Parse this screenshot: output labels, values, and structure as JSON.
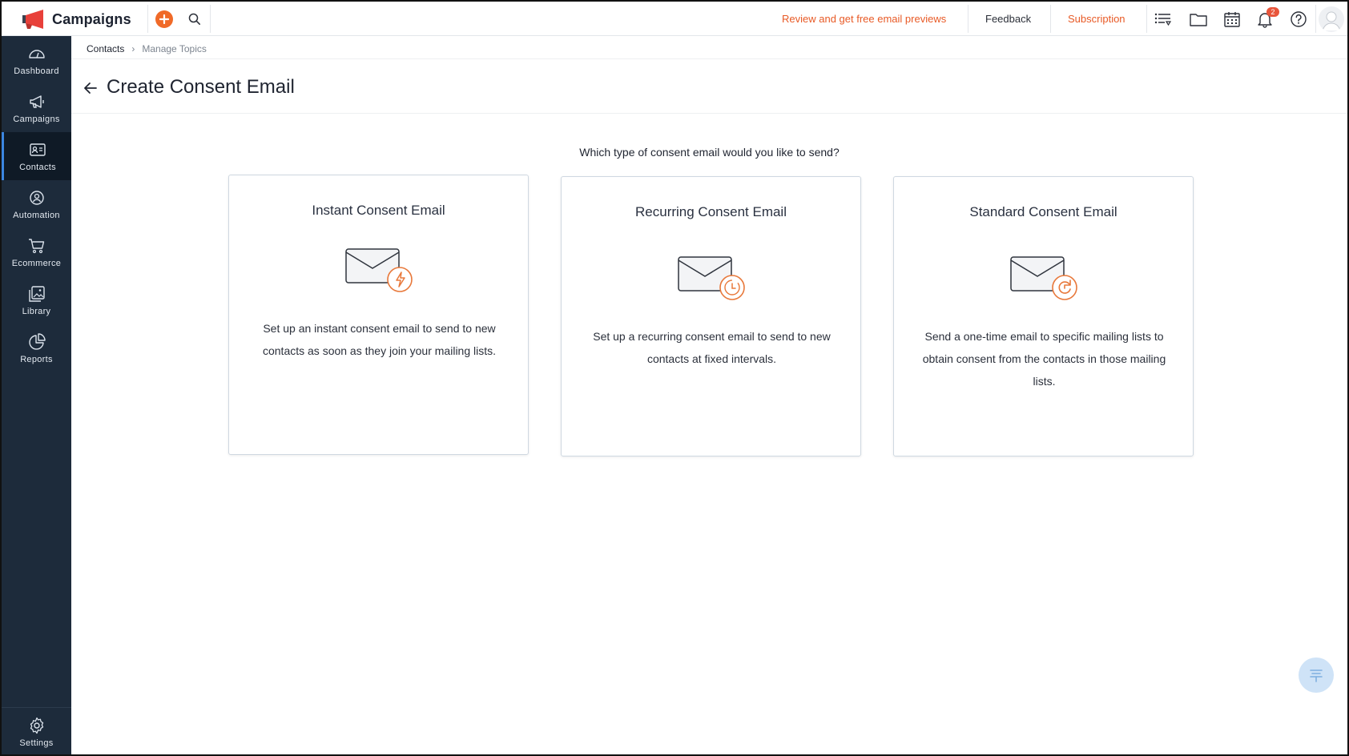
{
  "app": {
    "title": "Campaigns"
  },
  "topbar": {
    "review_link": "Review and get free email previews",
    "feedback": "Feedback",
    "subscription": "Subscription",
    "notifications_count": "2",
    "accent_color": "#f06a28"
  },
  "sidebar": {
    "items": [
      {
        "label": "Dashboard",
        "icon": "dashboard-icon"
      },
      {
        "label": "Campaigns",
        "icon": "megaphone-icon"
      },
      {
        "label": "Contacts",
        "icon": "contact-card-icon",
        "active": true
      },
      {
        "label": "Automation",
        "icon": "automation-icon"
      },
      {
        "label": "Ecommerce",
        "icon": "cart-icon"
      },
      {
        "label": "Library",
        "icon": "library-icon"
      },
      {
        "label": "Reports",
        "icon": "pie-chart-icon"
      }
    ],
    "settings_label": "Settings"
  },
  "breadcrumb": {
    "parent": "Contacts",
    "current": "Manage Topics"
  },
  "page": {
    "title": "Create Consent Email",
    "question": "Which type of consent email would you like to send?"
  },
  "cards": [
    {
      "title": "Instant Consent Email",
      "icon": "envelope-lightning-icon",
      "description": "Set up an instant consent email to send to new contacts as soon as they join your mailing lists."
    },
    {
      "title": "Recurring Consent Email",
      "icon": "envelope-clock-icon",
      "description": "Set up a recurring consent email to send to new contacts at fixed intervals."
    },
    {
      "title": "Standard Consent Email",
      "icon": "envelope-refresh-icon",
      "description": "Send a one-time email to specific mailing lists to obtain consent from the contacts in those mailing lists."
    }
  ]
}
